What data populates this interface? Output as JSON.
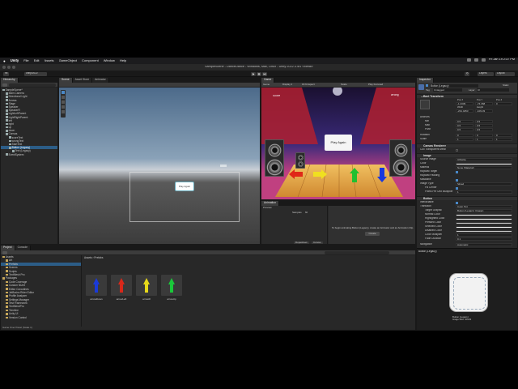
{
  "menubar": {
    "app": "Unity",
    "items": [
      "File",
      "Edit",
      "Assets",
      "GameObject",
      "Component",
      "Window",
      "Help"
    ],
    "clock": "Fri Jan 19  2:37 PM"
  },
  "window": {
    "title": "SampleScene - DanceDance - Windows, Mac, Linux - Unity 2022.3.4f1 <Metal>"
  },
  "toolbar": {
    "account": "ml",
    "branch": "unity/2022",
    "layers": "Layers",
    "layout": "Layout"
  },
  "hierarchy": {
    "tab": "Hierarchy",
    "items": [
      {
        "label": "SampleScene*",
        "depth": 0,
        "selected": false
      },
      {
        "label": "Main Camera",
        "depth": 1,
        "selected": false
      },
      {
        "label": "Directional Light",
        "depth": 1,
        "selected": false
      },
      {
        "label": "Arrows",
        "depth": 1,
        "selected": false
      },
      {
        "label": "Stage",
        "depth": 1,
        "selected": false
      },
      {
        "label": "Speaker",
        "depth": 1,
        "selected": false
      },
      {
        "label": "SpeakerR",
        "depth": 1,
        "selected": false
      },
      {
        "label": "LightLeftParent",
        "depth": 1,
        "selected": false
      },
      {
        "label": "LightRightParent",
        "depth": 1,
        "selected": false
      },
      {
        "label": "left",
        "depth": 1,
        "selected": false
      },
      {
        "label": "right",
        "depth": 1,
        "selected": false
      },
      {
        "label": "up",
        "depth": 1,
        "selected": false
      },
      {
        "label": "down",
        "depth": 1,
        "selected": false
      },
      {
        "label": "Canvas",
        "depth": 1,
        "selected": false
      },
      {
        "label": "scoreText",
        "depth": 2,
        "selected": false
      },
      {
        "label": "wrongText",
        "depth": 2,
        "selected": false
      },
      {
        "label": "StartText",
        "depth": 2,
        "selected": false
      },
      {
        "label": "Button (Legacy)",
        "depth": 2,
        "selected": true
      },
      {
        "label": "Text (Legacy)",
        "depth": 3,
        "selected": false
      },
      {
        "label": "EventSystem",
        "depth": 1,
        "selected": false
      }
    ]
  },
  "scene": {
    "tabs": [
      "Scene",
      "Asset Store",
      "Animator"
    ],
    "button_label": "Play Again"
  },
  "game": {
    "tab": "Game",
    "display": "Game",
    "display_select": "Display 1",
    "aspect_select": "16:9 Aspect",
    "scale": "Scale",
    "play_mode": "Play Focused",
    "score_label": "Score",
    "wrong_label": "wrong",
    "play_again": "Play Again"
  },
  "animation": {
    "tab": "Animation",
    "preview": "Preview",
    "samples": "Samples",
    "samples_value": "60",
    "message": "To begin animating Button (Legacy), create an Animator and an Animation Clip.",
    "create": "Create",
    "dopesheet": "Dopesheet",
    "curves": "Curves"
  },
  "project": {
    "tabs": [
      "Project",
      "Console"
    ],
    "tree": [
      {
        "label": "Assets",
        "depth": 0,
        "folder": true
      },
      {
        "label": "Art",
        "depth": 1,
        "folder": true
      },
      {
        "label": "Prefabs",
        "depth": 1,
        "folder": true
      },
      {
        "label": "Scenes",
        "depth": 1,
        "folder": true
      },
      {
        "label": "Scripts",
        "depth": 1,
        "folder": true
      },
      {
        "label": "TextMesh Pro",
        "depth": 1,
        "folder": true
      },
      {
        "label": "Packages",
        "depth": 0,
        "folder": true
      },
      {
        "label": "Code Coverage",
        "depth": 1,
        "folder": true
      },
      {
        "label": "Custom NUnit",
        "depth": 1,
        "folder": true
      },
      {
        "label": "Editor Coroutines",
        "depth": 1,
        "folder": true
      },
      {
        "label": "JetBrains Rider Editor",
        "depth": 1,
        "folder": true
      },
      {
        "label": "Profile Analyzer",
        "depth": 1,
        "folder": true
      },
      {
        "label": "Settings Manager",
        "depth": 1,
        "folder": true
      },
      {
        "label": "Test Framework",
        "depth": 1,
        "folder": true
      },
      {
        "label": "TextMeshPro",
        "depth": 1,
        "folder": true
      },
      {
        "label": "Timeline",
        "depth": 1,
        "folder": true
      },
      {
        "label": "Unity UI",
        "depth": 1,
        "folder": true
      },
      {
        "label": "Version Control",
        "depth": 1,
        "folder": true
      }
    ],
    "breadcrumb": [
      "Assets",
      "Prefabs"
    ],
    "assets": [
      {
        "name": "arrowDown",
        "color": "#1a3ad8"
      },
      {
        "name": "arrowLeft",
        "color": "#d8281a"
      },
      {
        "name": "arrowR",
        "color": "#e6d81a"
      },
      {
        "name": "arrowUp",
        "color": "#1ac83a"
      }
    ],
    "status": "Game Over Panel (Scale 1)"
  },
  "inspector": {
    "tab": "Inspector",
    "object_name": "Button (Legacy)",
    "static": "Static",
    "tag_label": "Tag",
    "tag_value": "Untagged",
    "layer_label": "Layer",
    "layer_value": "UI",
    "rect_transform": "Rect Transform",
    "anchor": "center",
    "pos_x_label": "Pos X",
    "pos_x": "-1.4339",
    "pos_y_label": "Pos Y",
    "pos_y": "-74.368",
    "pos_z_label": "Pos Z",
    "pos_z": "0",
    "width_label": "Width",
    "width": "-231.4453",
    "height_label": "Height",
    "height": "-109.33",
    "anchors": "Anchors",
    "min_label": "Min",
    "min_x": "0.5",
    "min_y": "0.5",
    "max_label": "Max",
    "max_x": "0.5",
    "max_y": "0.5",
    "pivot_label": "Pivot",
    "pivot_x": "0.5",
    "pivot_y": "0.5",
    "rotation_label": "Rotation",
    "rot_x": "0",
    "rot_y": "0",
    "rot_z": "0",
    "scale_label": "Scale",
    "scale_x": "1",
    "scale_y": "1",
    "scale_z": "1",
    "canvas_renderer": "Canvas Renderer",
    "cull_transparent": "Cull Transparent Mesh",
    "image": "Image",
    "source_image_label": "Source Image",
    "source_image": "UISprite",
    "color_label": "Color",
    "material_label": "Material",
    "material": "None (Material)",
    "raycast_target": "Raycast Target",
    "raycast_padding": "Raycast Padding",
    "maskable": "Maskable",
    "image_type_label": "Image Type",
    "image_type": "Sliced",
    "fill_center": "Fill Center",
    "ppu_label": "Pixels Per Unit Multiplier",
    "ppu": "1",
    "button": "Button",
    "interactable": "Interactable",
    "transition_label": "Transition",
    "transition": "Color Tint",
    "target_graphic_label": "Target Graphic",
    "target_graphic": "Button (Legacy) (Image)",
    "normal_color": "Normal Color",
    "highlighted_color": "Highlighted Color",
    "pressed_color": "Pressed Color",
    "selected_color": "Selected Color",
    "disabled_color": "Disabled Color",
    "color_multiplier_label": "Color Multiplier",
    "color_multiplier": "1",
    "fade_duration_label": "Fade Duration",
    "fade_duration": "0.1",
    "navigation_label": "Navigation",
    "navigation": "Automatic",
    "preview_title": "Button (Legacy)",
    "preview_caption": "Button (Legacy)\nImage Size: 32x32"
  },
  "colors": {
    "selection": "#2c5d87",
    "panel": "#282828",
    "stage_red": "#b02030",
    "stage_floor": "#e0a040"
  }
}
